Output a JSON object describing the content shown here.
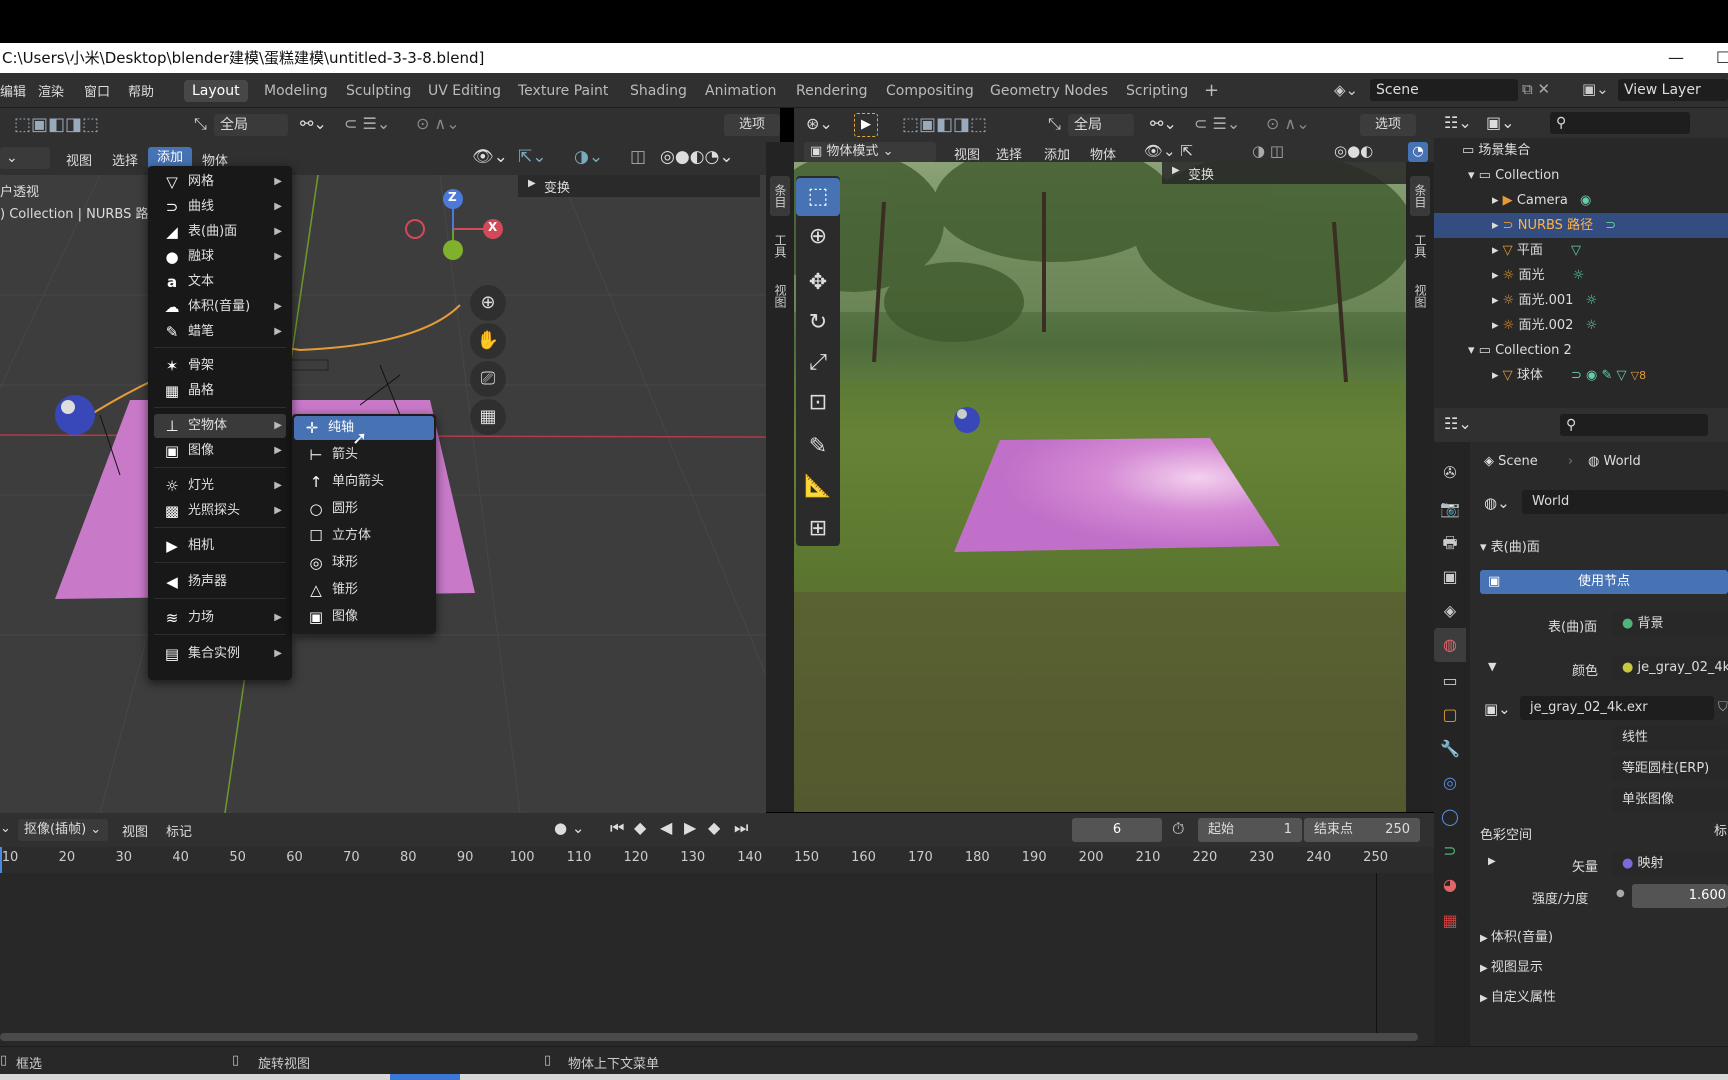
{
  "window": {
    "title": "C:\\Users\\小米\\Desktop\\blender建模\\蛋糕建模\\untitled-3-3-8.blend]",
    "min": "—",
    "max": "☐"
  },
  "menubar": {
    "items": [
      "编辑",
      "渲染",
      "窗口",
      "帮助"
    ],
    "workspaces": [
      "Layout",
      "Modeling",
      "Sculpting",
      "UV Editing",
      "Texture Paint",
      "Shading",
      "Animation",
      "Rendering",
      "Compositing",
      "Geometry Nodes",
      "Scripting"
    ],
    "add": "+",
    "scene": "Scene",
    "view_layer": "View Layer"
  },
  "left_viewport": {
    "transform_orient": "全局",
    "options": "选项",
    "menu_view": "视图",
    "menu_select": "选择",
    "menu_add": "添加",
    "menu_object": "物体",
    "overlay_line1": "户透视",
    "overlay_line2": ") Collection | NURBS 路",
    "transform_panel": "变换",
    "tabs": [
      "条目",
      "工具",
      "视图"
    ],
    "gizmo": {
      "z": "Z",
      "x": "X"
    }
  },
  "add_menu": {
    "items": [
      {
        "label": "网格",
        "icon": "mesh-icon",
        "glyph": "▽",
        "arrow": true
      },
      {
        "label": "曲线",
        "icon": "curve-icon",
        "glyph": "⊃",
        "arrow": true
      },
      {
        "label": "表(曲)面",
        "icon": "surface-icon",
        "glyph": "◢",
        "arrow": true
      },
      {
        "label": "融球",
        "icon": "metaball-icon",
        "glyph": "●",
        "arrow": true
      },
      {
        "label": "文本",
        "icon": "text-icon",
        "glyph": "a",
        "arrow": false
      },
      {
        "label": "体积(音量)",
        "icon": "volume-icon",
        "glyph": "☁",
        "arrow": true
      },
      {
        "label": "蜡笔",
        "icon": "grease-pencil-icon",
        "glyph": "✎",
        "arrow": true
      },
      {
        "label": "骨架",
        "icon": "armature-icon",
        "glyph": "✶",
        "arrow": false
      },
      {
        "label": "晶格",
        "icon": "lattice-icon",
        "glyph": "▦",
        "arrow": false
      },
      {
        "label": "空物体",
        "icon": "empty-icon",
        "glyph": "⊥",
        "arrow": true
      },
      {
        "label": "图像",
        "icon": "image-icon",
        "glyph": "▣",
        "arrow": true
      },
      {
        "label": "灯光",
        "icon": "light-icon",
        "glyph": "☼",
        "arrow": true
      },
      {
        "label": "光照探头",
        "icon": "light-probe-icon",
        "glyph": "▩",
        "arrow": true
      },
      {
        "label": "相机",
        "icon": "camera-icon",
        "glyph": "▶",
        "arrow": false
      },
      {
        "label": "扬声器",
        "icon": "speaker-icon",
        "glyph": "◀",
        "arrow": false
      },
      {
        "label": "力场",
        "icon": "force-field-icon",
        "glyph": "≋",
        "arrow": true
      },
      {
        "label": "集合实例",
        "icon": "collection-instance-icon",
        "glyph": "▤",
        "arrow": true
      }
    ]
  },
  "empty_submenu": {
    "items": [
      {
        "label": "纯轴",
        "icon": "plain-axes-icon",
        "glyph": "✛"
      },
      {
        "label": "箭头",
        "icon": "arrows-icon",
        "glyph": "⊢"
      },
      {
        "label": "单向箭头",
        "icon": "single-arrow-icon",
        "glyph": "↑"
      },
      {
        "label": "圆形",
        "icon": "circle-icon",
        "glyph": "○"
      },
      {
        "label": "立方体",
        "icon": "cube-icon",
        "glyph": "☐"
      },
      {
        "label": "球形",
        "icon": "sphere-icon",
        "glyph": "◎"
      },
      {
        "label": "锥形",
        "icon": "cone-icon",
        "glyph": "△"
      },
      {
        "label": "图像",
        "icon": "image-empty-icon",
        "glyph": "▣"
      }
    ]
  },
  "right_viewport": {
    "mode": "物体模式",
    "menu_view": "视图",
    "menu_select": "选择",
    "menu_add": "添加",
    "menu_object": "物体",
    "transform_orient": "全局",
    "options": "选项",
    "transform_panel": "变换",
    "tabs": [
      "条目",
      "工具",
      "视图"
    ]
  },
  "outliner": {
    "root": "场景集合",
    "rows": [
      {
        "name": "Collection",
        "indent": 1,
        "icon": "collection-icon",
        "glyph": "▭",
        "color": "#ddd"
      },
      {
        "name": "Camera",
        "indent": 2,
        "icon": "camera-object-icon",
        "glyph": "▶",
        "color": "#ddd"
      },
      {
        "name": "NURBS 路径",
        "indent": 2,
        "icon": "curve-object-icon",
        "glyph": "⊃",
        "color": "#ffb347",
        "selected": true
      },
      {
        "name": "平面",
        "indent": 2,
        "icon": "mesh-object-icon",
        "glyph": "▽",
        "color": "#ddd"
      },
      {
        "name": "面光",
        "indent": 2,
        "icon": "light-object-icon",
        "glyph": "☼",
        "color": "#ddd"
      },
      {
        "name": "面光.001",
        "indent": 2,
        "icon": "light-object-icon",
        "glyph": "☼",
        "color": "#ddd"
      },
      {
        "name": "面光.002",
        "indent": 2,
        "icon": "light-object-icon",
        "glyph": "☼",
        "color": "#ddd"
      },
      {
        "name": "Collection 2",
        "indent": 1,
        "icon": "collection-icon",
        "glyph": "▭",
        "color": "#ddd"
      },
      {
        "name": "球体",
        "indent": 2,
        "icon": "mesh-object-icon",
        "glyph": "▽",
        "color": "#ddd"
      }
    ],
    "badge": "8"
  },
  "properties": {
    "breadcrumb_scene": "Scene",
    "breadcrumb_world": "World",
    "world_name": "World",
    "section_surface": "表(曲)面",
    "use_nodes": "使用节点",
    "surface_label": "表(曲)面",
    "surface_value": "背景",
    "color_label": "颜色",
    "color_value": "je_gray_02_4k.",
    "image_name": "je_gray_02_4k.exr",
    "interp": "线性",
    "projection": "等距圆柱(ERP)",
    "source": "单张图像",
    "colorspace_label": "色彩空间",
    "colorspace_value": "标",
    "vector_label": "矢量",
    "vector_value": "映射",
    "strength_label": "强度/力度",
    "strength_value": "1.600",
    "sections": [
      "体积(音量)",
      "视图显示",
      "自定义属性"
    ]
  },
  "timeline": {
    "mode": "抠像(插帧)",
    "view": "视图",
    "marker": "标记",
    "current_frame": "6",
    "start_label": "起始",
    "start_value": "1",
    "end_label": "结束点",
    "end_value": "250",
    "ticks": [
      "10",
      "20",
      "30",
      "40",
      "50",
      "60",
      "70",
      "80",
      "90",
      "100",
      "110",
      "120",
      "130",
      "140",
      "150",
      "160",
      "170",
      "180",
      "190",
      "200",
      "210",
      "220",
      "230",
      "240",
      "250"
    ]
  },
  "statusbar": {
    "left": "框选",
    "middle": "旋转视图",
    "right": "物体上下文菜单"
  }
}
